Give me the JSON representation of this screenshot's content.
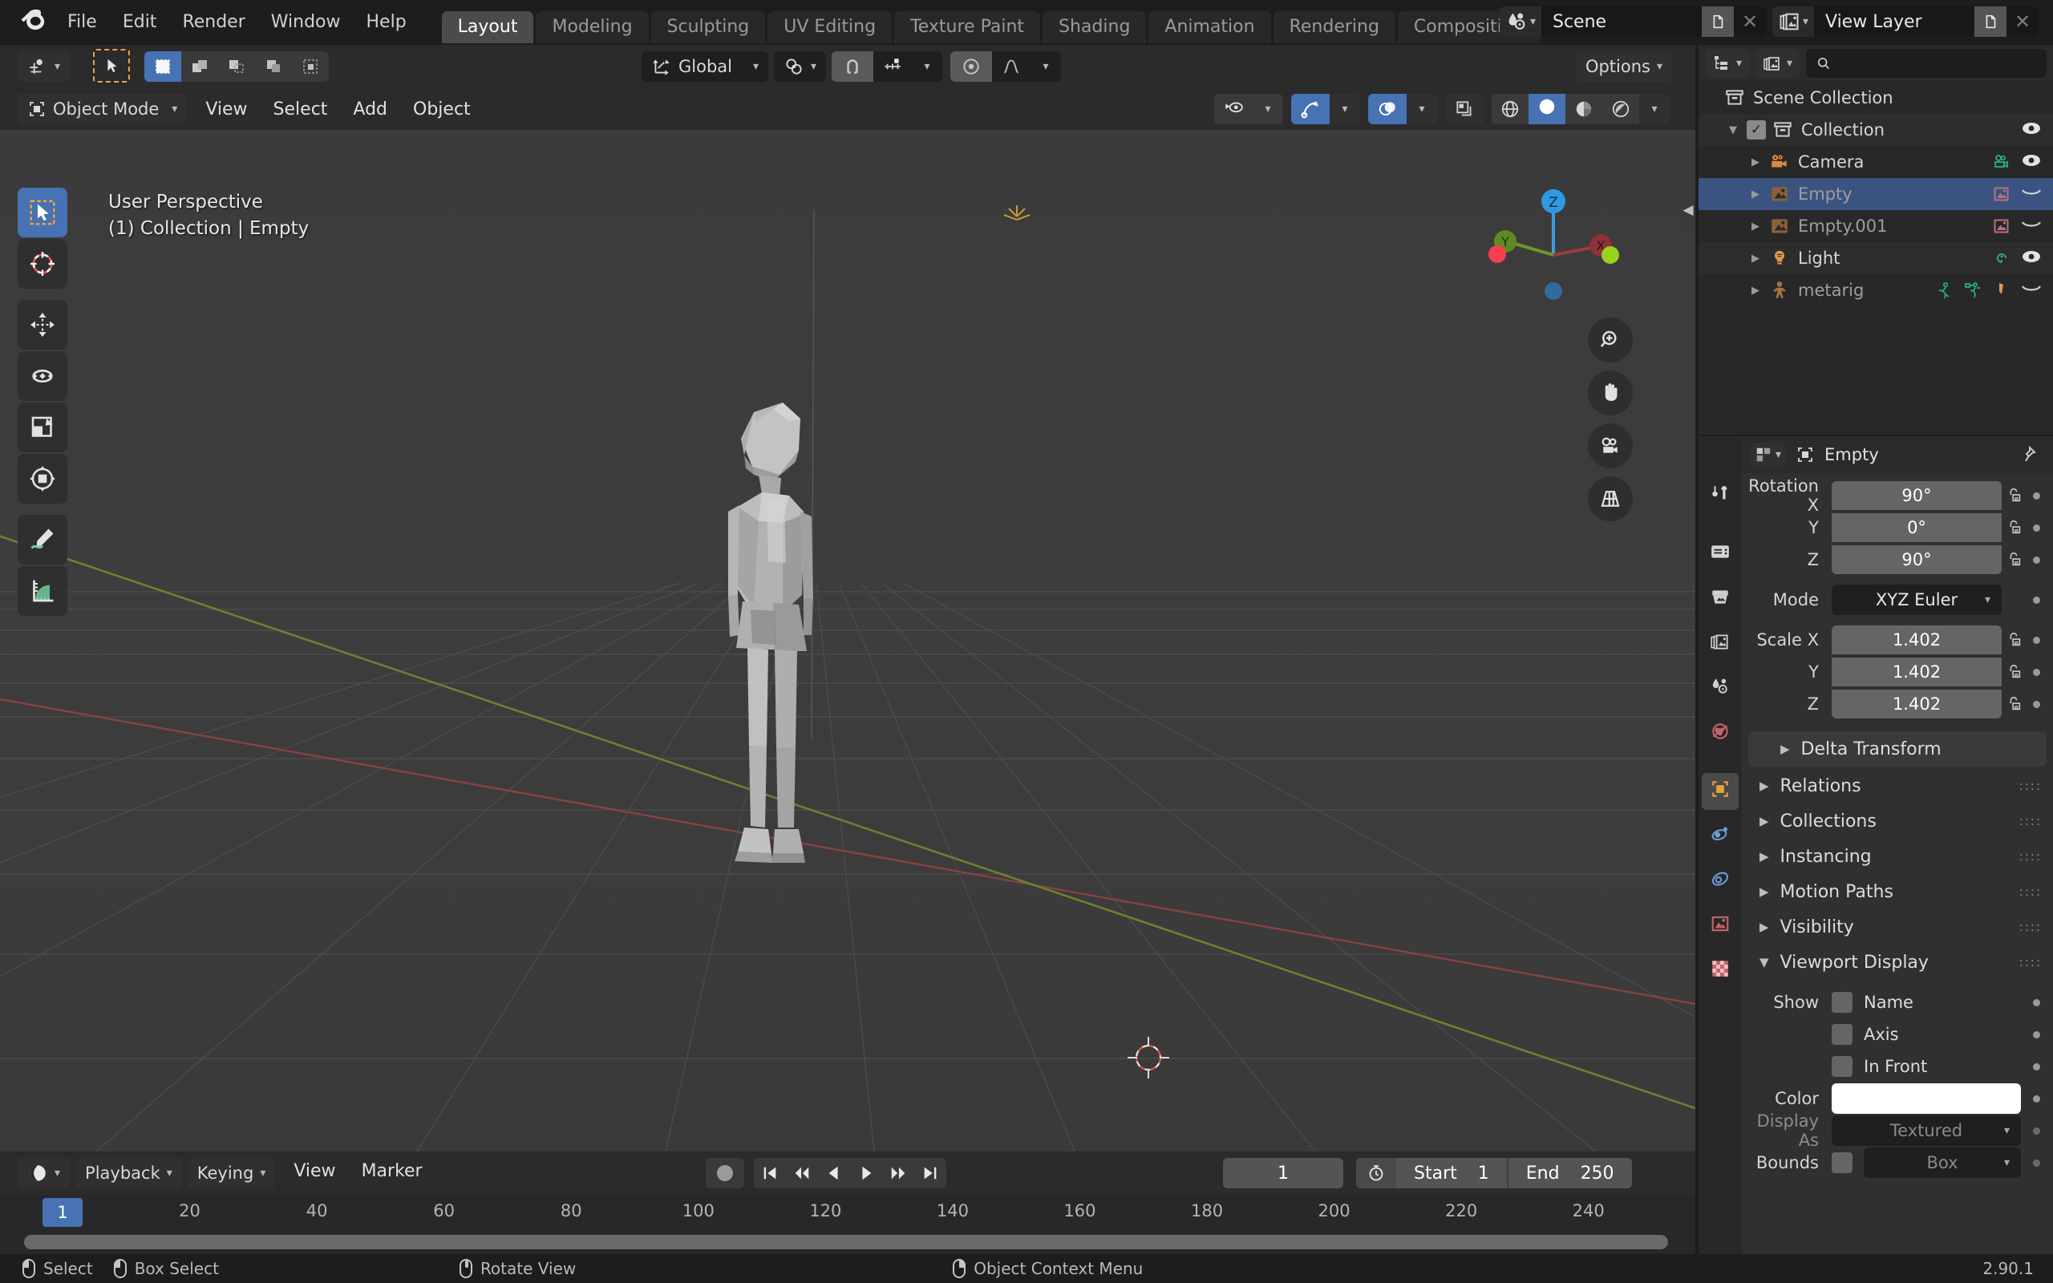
{
  "topbar": {
    "menus": [
      "File",
      "Edit",
      "Render",
      "Window",
      "Help"
    ],
    "workspace_tabs": [
      {
        "label": "Layout",
        "active": true
      },
      {
        "label": "Modeling",
        "active": false
      },
      {
        "label": "Sculpting",
        "active": false
      },
      {
        "label": "UV Editing",
        "active": false
      },
      {
        "label": "Texture Paint",
        "active": false
      },
      {
        "label": "Shading",
        "active": false
      },
      {
        "label": "Animation",
        "active": false
      },
      {
        "label": "Rendering",
        "active": false
      },
      {
        "label": "Compositing",
        "active": false
      }
    ],
    "scene": {
      "name": "Scene",
      "icon": "scene-icon",
      "new_label": "⧉",
      "close_label": "✕"
    },
    "view_layer": {
      "name": "View Layer",
      "icon": "view-layer-icon",
      "new_label": "⧉",
      "close_label": "✕"
    }
  },
  "viewport": {
    "header": {
      "editor_type_icon": "editor-type-3dview-icon",
      "select_mode_label": "",
      "transform_orientation": "Global",
      "mode": "Object Mode",
      "menus": [
        "View",
        "Select",
        "Add",
        "Object"
      ],
      "options_label": "Options"
    },
    "overlay_text_line1": "User Perspective",
    "overlay_text_line2": "(1) Collection | Empty",
    "gizmo": {
      "x": "X",
      "y": "Y",
      "z": "Z"
    },
    "tools": [
      {
        "name": "tweak-tool",
        "active": true
      },
      {
        "name": "cursor-tool",
        "active": false
      },
      {
        "name": "move-tool",
        "active": false
      },
      {
        "name": "rotate-tool",
        "active": false
      },
      {
        "name": "scale-tool",
        "active": false
      },
      {
        "name": "transform-tool",
        "active": false
      },
      {
        "name": "annotate-tool",
        "active": false
      },
      {
        "name": "measure-tool",
        "active": false
      }
    ]
  },
  "timeline": {
    "editor_icon": "timeline-icon",
    "menus": [
      "Playback",
      "Keying",
      "View",
      "Marker"
    ],
    "current_frame": "1",
    "start_label": "Start",
    "start_value": "1",
    "end_label": "End",
    "end_value": "250",
    "playhead_frame": "1",
    "ticks": [
      "20",
      "40",
      "60",
      "80",
      "100",
      "120",
      "140",
      "160",
      "180",
      "200",
      "220",
      "240"
    ],
    "tick_values": [
      20,
      40,
      60,
      80,
      100,
      120,
      140,
      160,
      180,
      200,
      220,
      240
    ]
  },
  "outliner": {
    "display_mode_icon": "outliner-mode-icon",
    "filter_icon": "view-layer-icon",
    "search_placeholder": "",
    "rows": [
      {
        "label": "Scene Collection",
        "icon": "collection-icon",
        "depth": 0,
        "selected": false,
        "dim": false,
        "vis": "",
        "has_check": false,
        "has_disclosure": false
      },
      {
        "label": "Collection",
        "icon": "collection-icon",
        "depth": 1,
        "selected": false,
        "dim": false,
        "vis": "eye",
        "has_check": true,
        "has_disclosure": true
      },
      {
        "label": "Camera",
        "icon": "camera-icon",
        "depth": 2,
        "selected": false,
        "dim": false,
        "vis": "eye",
        "has_check": false,
        "has_disclosure": true,
        "data_icons": [
          "camera-data-icon"
        ]
      },
      {
        "label": "Empty",
        "icon": "empty-image-icon",
        "depth": 2,
        "selected": true,
        "dim": true,
        "vis": "closed-eye",
        "has_check": false,
        "has_disclosure": true,
        "data_icons": [
          "empty-image-data-icon"
        ]
      },
      {
        "label": "Empty.001",
        "icon": "empty-image-icon",
        "depth": 2,
        "selected": false,
        "dim": true,
        "vis": "closed-eye",
        "has_check": false,
        "has_disclosure": true,
        "data_icons": [
          "empty-image-data-icon"
        ]
      },
      {
        "label": "Light",
        "icon": "light-icon",
        "depth": 2,
        "selected": false,
        "dim": false,
        "vis": "eye",
        "has_check": false,
        "has_disclosure": true,
        "data_icons": [
          "light-data-icon"
        ]
      },
      {
        "label": "metarig",
        "icon": "armature-icon",
        "depth": 2,
        "selected": false,
        "dim": true,
        "vis": "closed-eye",
        "has_check": false,
        "has_disclosure": true,
        "data_icons": [
          "pose-icon",
          "armature-data-icon",
          "modifier-icon"
        ]
      }
    ]
  },
  "properties": {
    "breadcrumb_icon": "object-properties-icon",
    "breadcrumb_label": "Empty",
    "pin_icon": "pin-icon",
    "tabs": [
      {
        "name": "tool-tab",
        "icon": "tool-icon",
        "active": false
      },
      {
        "name": "render-tab",
        "icon": "render-icon",
        "active": false
      },
      {
        "name": "output-tab",
        "icon": "output-icon",
        "active": false
      },
      {
        "name": "view-layer-tab",
        "icon": "view-layer-icon",
        "active": false
      },
      {
        "name": "scene-tab",
        "icon": "scene-icon",
        "active": false
      },
      {
        "name": "world-tab",
        "icon": "world-icon",
        "active": false
      },
      {
        "name": "object-tab",
        "icon": "object-icon",
        "active": true
      },
      {
        "name": "physics-tab",
        "icon": "physics-icon",
        "active": false
      },
      {
        "name": "constraints-tab",
        "icon": "constraints-icon",
        "active": false
      },
      {
        "name": "object-data-tab",
        "icon": "empty-image-data-icon",
        "active": false
      },
      {
        "name": "texture-tab",
        "icon": "texture-icon",
        "active": false
      }
    ],
    "transform": {
      "rotation_x_label": "Rotation X",
      "rotation_x": "90°",
      "rotation_y_label": "Y",
      "rotation_y": "0°",
      "rotation_z_label": "Z",
      "rotation_z": "90°",
      "mode_label": "Mode",
      "mode_value": "XYZ Euler",
      "scale_x_label": "Scale X",
      "scale_x": "1.402",
      "scale_y_label": "Y",
      "scale_y": "1.402",
      "scale_z_label": "Z",
      "scale_z": "1.402"
    },
    "panels": [
      {
        "label": "Delta Transform",
        "open": false,
        "sub": true
      },
      {
        "label": "Relations",
        "open": false,
        "sub": false
      },
      {
        "label": "Collections",
        "open": false,
        "sub": false
      },
      {
        "label": "Instancing",
        "open": false,
        "sub": false
      },
      {
        "label": "Motion Paths",
        "open": false,
        "sub": false
      },
      {
        "label": "Visibility",
        "open": false,
        "sub": false
      },
      {
        "label": "Viewport Display",
        "open": true,
        "sub": false
      }
    ],
    "viewport_display": {
      "show_label": "Show",
      "name_label": "Name",
      "axis_label": "Axis",
      "in_front_label": "In Front",
      "color_label": "Color",
      "color_value": "#ffffff",
      "display_as_label": "Display As",
      "display_as_value": "Textured",
      "bounds_label": "Bounds",
      "bounds_value": "Box"
    }
  },
  "statusbar": {
    "items": [
      {
        "mouse": "lmb",
        "label": "Select"
      },
      {
        "mouse": "lmb-drag",
        "label": "Box Select"
      },
      {
        "mouse": "mmb",
        "label": "Rotate View"
      },
      {
        "mouse": "rmb",
        "label": "Object Context Menu"
      }
    ],
    "version": "2.90.1"
  }
}
